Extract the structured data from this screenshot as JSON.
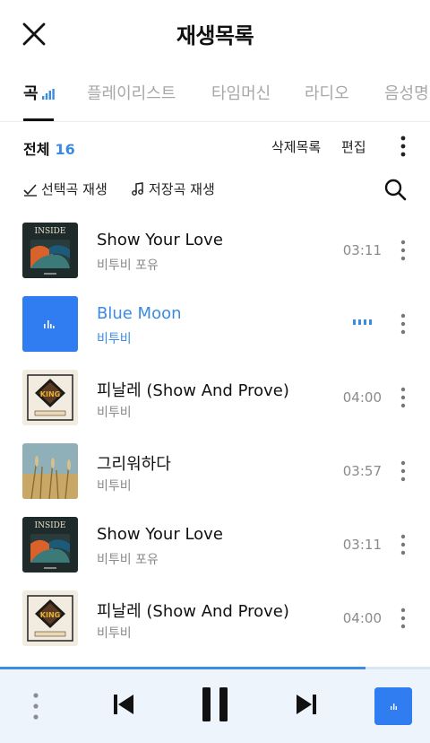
{
  "header": {
    "title": "재생목록",
    "close_icon": "close-icon"
  },
  "tabs": [
    {
      "label": "곡",
      "active": true
    },
    {
      "label": "플레이리스트",
      "active": false
    },
    {
      "label": "타임머신",
      "active": false
    },
    {
      "label": "라디오",
      "active": false
    },
    {
      "label": "음성명",
      "active": false
    }
  ],
  "summary": {
    "label": "전체",
    "count": "16"
  },
  "actions": {
    "delete_list": "삭제목록",
    "edit": "편집"
  },
  "options": {
    "play_selected": "선택곡 재생",
    "play_saved": "저장곡 재생"
  },
  "colors": {
    "accent": "#3b8be3",
    "player_bg": "#edf4fc"
  },
  "songs": [
    {
      "title": "Show Your Love",
      "artist": "비투비 포유",
      "duration": "03:11",
      "art": "inside",
      "playing": false
    },
    {
      "title": "Blue Moon",
      "artist": "비투비",
      "duration": "",
      "art": "bluemoon",
      "playing": true
    },
    {
      "title": "피날레 (Show And Prove)",
      "artist": "비투비",
      "duration": "04:00",
      "art": "finale",
      "playing": false
    },
    {
      "title": "그리워하다",
      "artist": "비투비",
      "duration": "03:57",
      "art": "field",
      "playing": false
    },
    {
      "title": "Show Your Love",
      "artist": "비투비 포유",
      "duration": "03:11",
      "art": "inside",
      "playing": false
    },
    {
      "title": "피날레 (Show And Prove)",
      "artist": "비투비",
      "duration": "04:00",
      "art": "finale",
      "playing": false
    }
  ],
  "album_art_text": {
    "inside": "INSIDE",
    "finale_logo": "KING"
  },
  "player": {
    "progress": 0.85
  }
}
